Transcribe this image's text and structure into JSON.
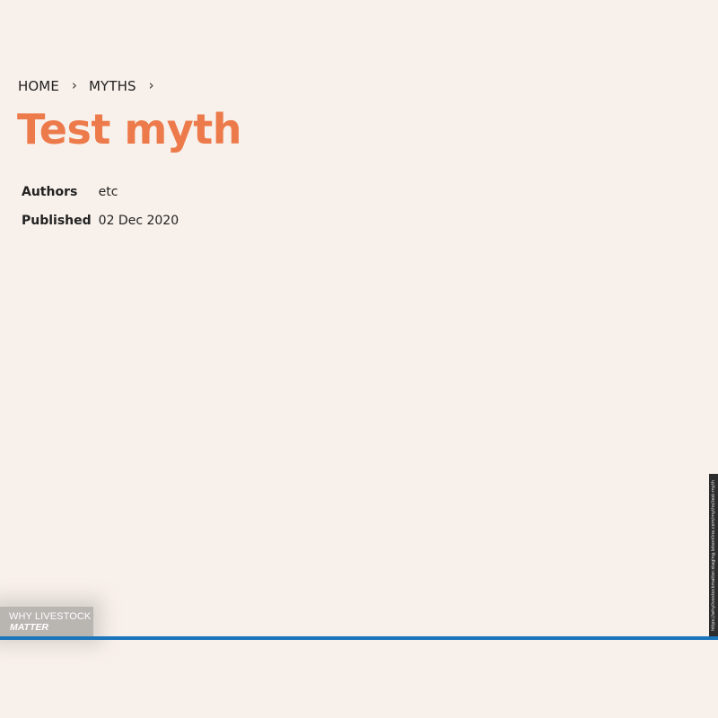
{
  "breadcrumb": {
    "items": [
      {
        "label": "HOME"
      },
      {
        "label": "MYTHS"
      }
    ]
  },
  "article": {
    "title": "Test myth",
    "meta": {
      "authors_label": "Authors",
      "authors_value": "etc",
      "published_label": "Published",
      "published_value": "02 Dec 2020"
    }
  },
  "logo": {
    "line1": "WHY LIVESTOCK",
    "line2": "MATTER"
  },
  "page_url": "https://whylivestockmatter.staging.lolsonline.com/myths/test-myth",
  "colors": {
    "background": "#f8f0ea",
    "title": "#ec7a4a",
    "accent_line": "#1a75bb"
  }
}
